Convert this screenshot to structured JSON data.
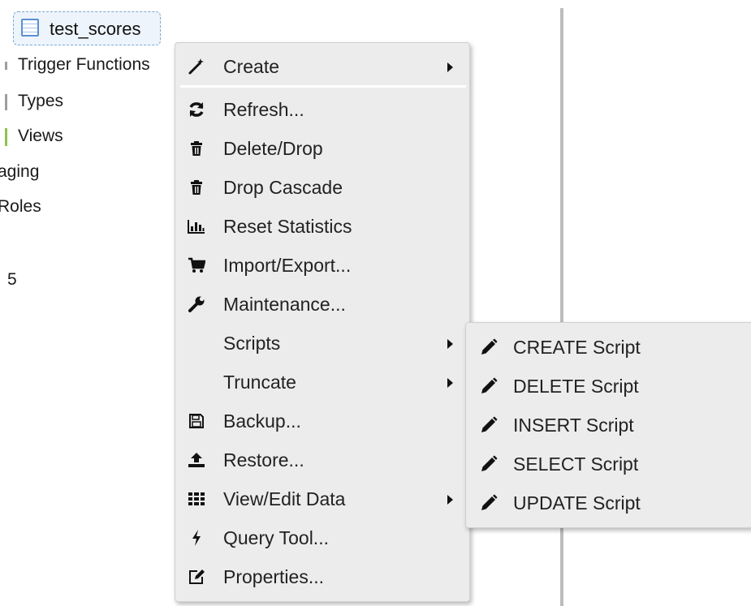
{
  "tree": {
    "selected_node_label": "test_scores",
    "items": [
      {
        "label": "Trigger Functions"
      },
      {
        "label": "Types"
      },
      {
        "label": "Views"
      },
      {
        "label": "aging"
      },
      {
        "label": "Roles"
      },
      {
        "label": "5"
      }
    ]
  },
  "context_menu": {
    "items": [
      {
        "label": "Create",
        "icon": "magic-wand-icon",
        "submenu": true
      },
      {
        "label": "Refresh...",
        "icon": "refresh-icon"
      },
      {
        "label": "Delete/Drop",
        "icon": "trash-icon"
      },
      {
        "label": "Drop Cascade",
        "icon": "trash-icon"
      },
      {
        "label": "Reset Statistics",
        "icon": "bar-chart-icon"
      },
      {
        "label": "Import/Export...",
        "icon": "cart-icon"
      },
      {
        "label": "Maintenance...",
        "icon": "wrench-icon"
      },
      {
        "label": "Scripts",
        "icon": "",
        "submenu": true
      },
      {
        "label": "Truncate",
        "icon": "",
        "submenu": true
      },
      {
        "label": "Backup...",
        "icon": "floppy-disk-icon"
      },
      {
        "label": "Restore...",
        "icon": "upload-icon"
      },
      {
        "label": "View/Edit Data",
        "icon": "grid-icon",
        "submenu": true
      },
      {
        "label": "Query Tool...",
        "icon": "lightning-icon"
      },
      {
        "label": "Properties...",
        "icon": "edit-icon"
      }
    ]
  },
  "scripts_submenu": {
    "items": [
      {
        "label": "CREATE Script",
        "icon": "pencil-icon"
      },
      {
        "label": "DELETE Script",
        "icon": "pencil-icon"
      },
      {
        "label": "INSERT Script",
        "icon": "pencil-icon"
      },
      {
        "label": "SELECT Script",
        "icon": "pencil-icon"
      },
      {
        "label": "UPDATE Script",
        "icon": "pencil-icon"
      }
    ]
  },
  "colors": {
    "menu_bg": "#ececec",
    "selected_node_bg": "#eef4fb",
    "selected_node_border": "#7aa7d6",
    "views_marker": "#8bc34a"
  }
}
